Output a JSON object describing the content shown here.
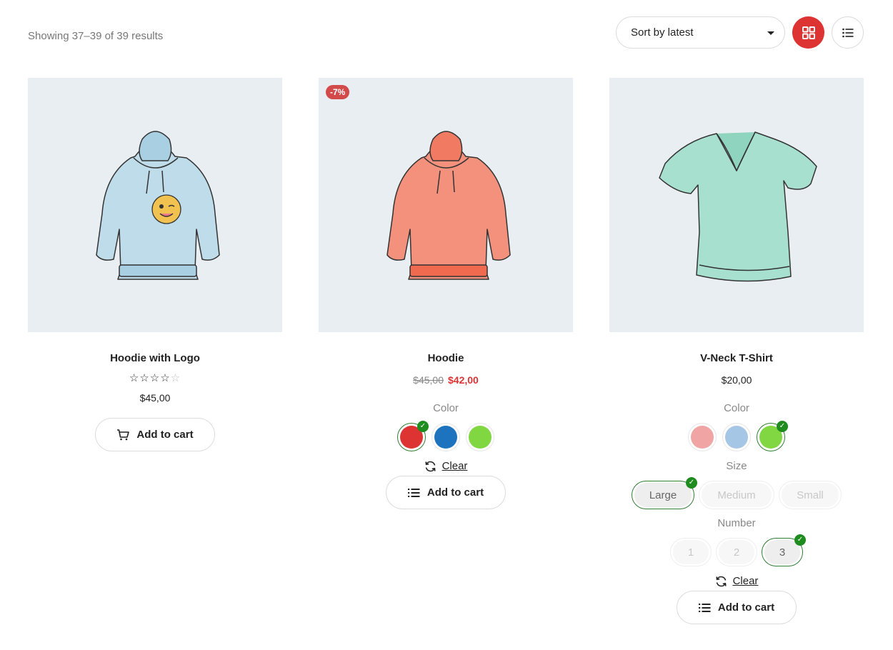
{
  "toolbar": {
    "result_count": "Showing 37–39 of 39 results",
    "sort_value": "Sort by latest",
    "accent_color": "#dd3333"
  },
  "products": [
    {
      "title": "Hoodie with Logo",
      "rating": 4,
      "rating_max": 5,
      "price": "$45,00",
      "button_label": "Add to cart",
      "button_icon": "cart-icon",
      "image": "light blue hoodie with winking emoji logo"
    },
    {
      "title": "Hoodie",
      "badge": "-7%",
      "price_old": "$45,00",
      "price_new": "$42,00",
      "color_label": "Color",
      "colors": [
        {
          "name": "red",
          "hex": "#dd3333",
          "selected": true
        },
        {
          "name": "blue",
          "hex": "#1e73be",
          "selected": false
        },
        {
          "name": "green",
          "hex": "#81d742",
          "selected": false
        }
      ],
      "clear_label": "Clear",
      "button_label": "Add to cart",
      "button_icon": "list-icon",
      "image": "coral hoodie"
    },
    {
      "title": "V-Neck T-Shirt",
      "price": "$20,00",
      "color_label": "Color",
      "colors": [
        {
          "name": "pink",
          "hex": "#f0a4a4",
          "selected": false
        },
        {
          "name": "light-blue",
          "hex": "#a6c6e6",
          "selected": false
        },
        {
          "name": "green",
          "hex": "#81d742",
          "selected": true
        }
      ],
      "size_label": "Size",
      "sizes": [
        {
          "label": "Large",
          "selected": true
        },
        {
          "label": "Medium",
          "selected": false
        },
        {
          "label": "Small",
          "selected": false
        }
      ],
      "number_label": "Number",
      "numbers": [
        {
          "label": "1",
          "selected": false
        },
        {
          "label": "2",
          "selected": false
        },
        {
          "label": "3",
          "selected": true
        }
      ],
      "clear_label": "Clear",
      "button_label": "Add to cart",
      "button_icon": "list-icon",
      "image": "mint green v-neck t-shirt"
    }
  ]
}
